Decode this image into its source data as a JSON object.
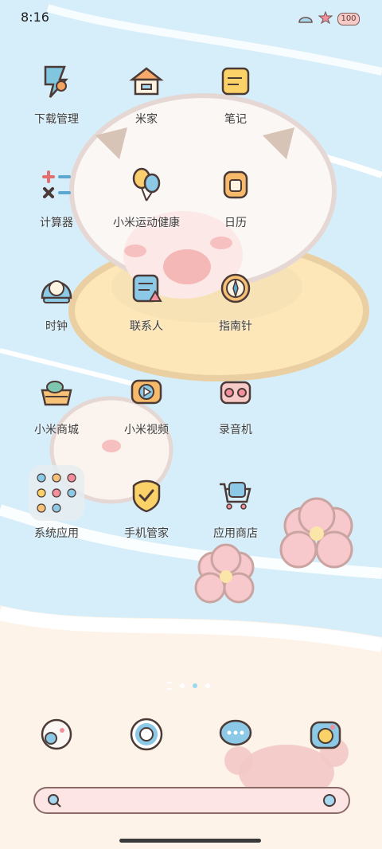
{
  "status_bar": {
    "time": "8:16",
    "battery": "100"
  },
  "apps": [
    {
      "label": "下载管理",
      "icon": "download-manager-icon"
    },
    {
      "label": "米家",
      "icon": "home-icon"
    },
    {
      "label": "笔记",
      "icon": "notes-icon"
    },
    {
      "label": "计算器",
      "icon": "calculator-icon"
    },
    {
      "label": "小米运动健康",
      "icon": "balloon-icon"
    },
    {
      "label": "日历",
      "icon": "calendar-icon"
    },
    {
      "label": "时钟",
      "icon": "clock-icon"
    },
    {
      "label": "联系人",
      "icon": "contacts-icon"
    },
    {
      "label": "指南针",
      "icon": "compass-icon"
    },
    {
      "label": "小米商城",
      "icon": "shopping-basket-icon"
    },
    {
      "label": "小米视频",
      "icon": "video-icon"
    },
    {
      "label": "录音机",
      "icon": "recorder-icon"
    },
    {
      "label": "系统应用",
      "icon": "folder-icon"
    },
    {
      "label": "手机管家",
      "icon": "security-icon"
    },
    {
      "label": "应用商店",
      "icon": "app-store-icon"
    }
  ],
  "dock": [
    {
      "icon": "sheep-gallery-icon"
    },
    {
      "icon": "browser-ring-icon"
    },
    {
      "icon": "messages-icon"
    },
    {
      "icon": "camera-icon"
    }
  ],
  "colors": {
    "sky": "#d9f0fb",
    "sand": "#fdf1e6",
    "accent_pink": "#f7c9c7",
    "outline": "#7a5b55"
  }
}
